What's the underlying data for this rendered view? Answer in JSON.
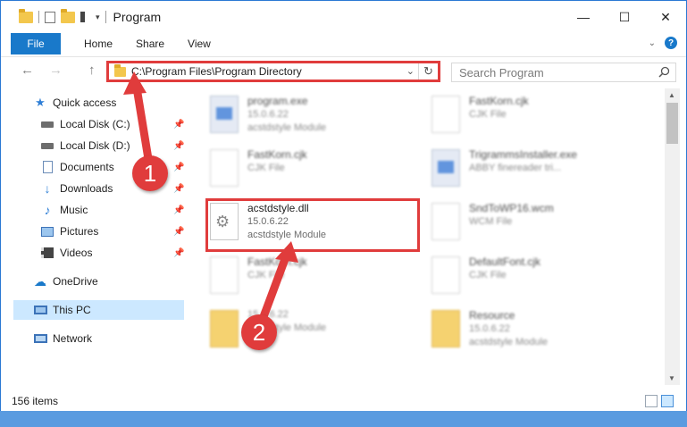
{
  "window": {
    "title": "Program",
    "controls": {
      "minimize": "—",
      "maximize": "☐",
      "close": "✕"
    }
  },
  "ribbon": {
    "tabs": [
      "File",
      "Home",
      "Share",
      "View"
    ]
  },
  "nav": {
    "back": "←",
    "forward": "→",
    "up": "↑",
    "address": "C:\\Program Files\\Program Directory",
    "search_placeholder": "Search Program"
  },
  "sidebar": {
    "items": [
      {
        "label": "Quick access",
        "icon": "star-icon"
      },
      {
        "label": "Local Disk (C:)",
        "icon": "drive-icon",
        "pinned": true
      },
      {
        "label": "Local Disk (D:)",
        "icon": "drive-icon",
        "pinned": true
      },
      {
        "label": "Documents",
        "icon": "documents-icon",
        "pinned": true
      },
      {
        "label": "Downloads",
        "icon": "downloads-icon",
        "pinned": true
      },
      {
        "label": "Music",
        "icon": "music-icon",
        "pinned": true
      },
      {
        "label": "Pictures",
        "icon": "pictures-icon",
        "pinned": true
      },
      {
        "label": "Videos",
        "icon": "videos-icon",
        "pinned": true
      },
      {
        "label": "OneDrive",
        "icon": "cloud-icon"
      },
      {
        "label": "This PC",
        "icon": "computer-icon",
        "selected": true
      },
      {
        "label": "Network",
        "icon": "network-icon"
      }
    ]
  },
  "files": [
    {
      "name": "program.exe",
      "line2": "15.0.6.22",
      "line3": "acstdstyle Module",
      "type": "exe"
    },
    {
      "name": "FastKorn.cjk",
      "line2": "CJK File",
      "line3": "",
      "type": "file"
    },
    {
      "name": "FastKorn.cjk",
      "line2": "CJK File",
      "line3": "",
      "type": "file"
    },
    {
      "name": "TrigrammsInstaller.exe",
      "line2": "ABBY finereader tri...",
      "line3": "",
      "type": "exe"
    },
    {
      "name": "acstdstyle.dll",
      "line2": "15.0.6.22",
      "line3": "acstdstyle Module",
      "type": "dll",
      "highlighted": true
    },
    {
      "name": "SndToWP16.wcm",
      "line2": "WCM File",
      "line3": "",
      "type": "file"
    },
    {
      "name": "FastKorn.cjk",
      "line2": "CJK File",
      "line3": "",
      "type": "file"
    },
    {
      "name": "DefaultFont.cjk",
      "line2": "CJK File",
      "line3": "",
      "type": "file"
    },
    {
      "name": "",
      "line2": "15.0.6.22",
      "line3": "acstdstyle Module",
      "type": "folder"
    },
    {
      "name": "Resource",
      "line2": "15.0.6.22",
      "line3": "acstdstyle Module",
      "type": "folder"
    }
  ],
  "status": {
    "item_count": "156 items"
  },
  "callouts": [
    "1",
    "2"
  ],
  "colors": {
    "accent": "#1979ca",
    "highlight": "#e03c3c",
    "selected": "#cce8ff"
  }
}
